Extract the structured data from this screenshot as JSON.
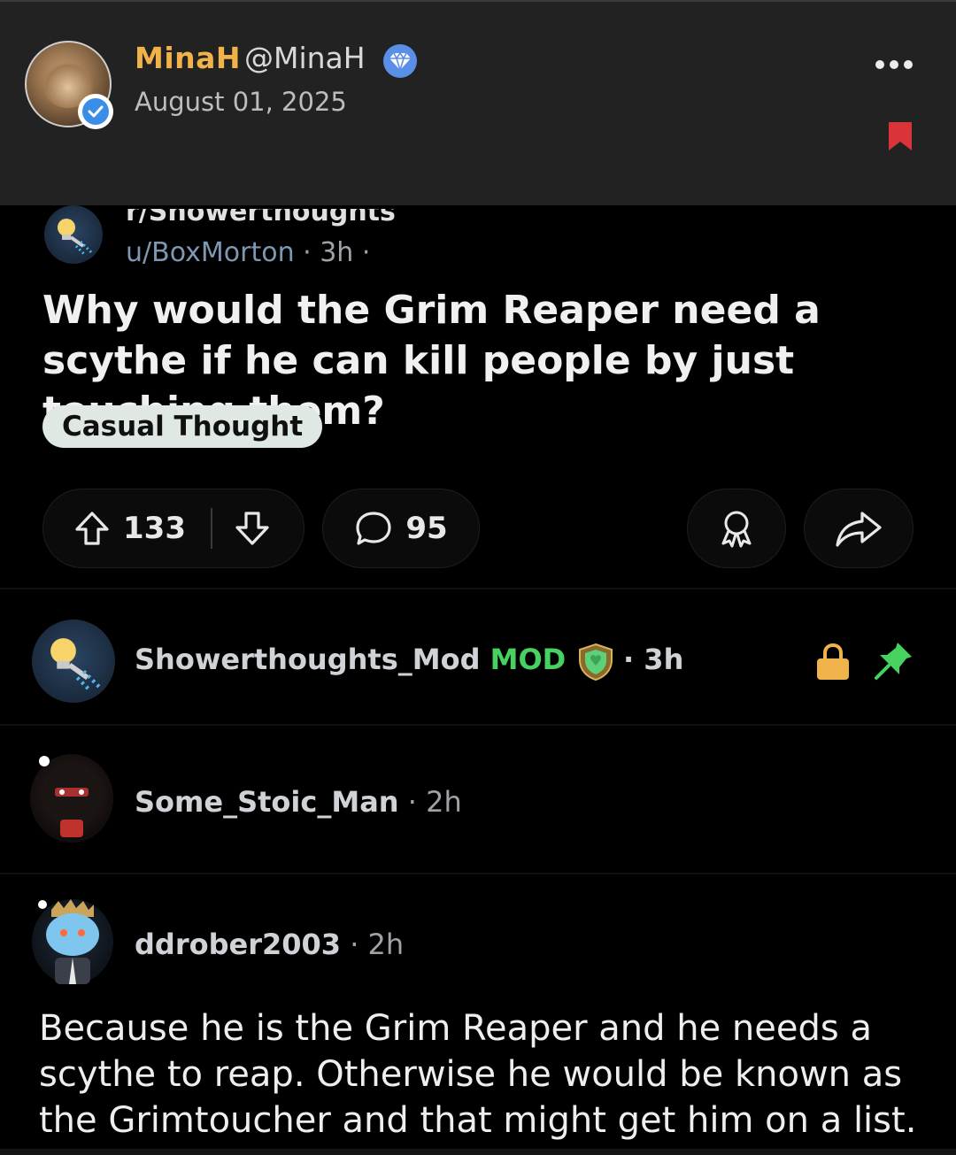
{
  "card": {
    "author_name": "MinaH",
    "author_handle": "@MinaH",
    "date": "August 01, 2025"
  },
  "post": {
    "subreddit": "r/Showerthoughts",
    "user": "u/BoxMorton",
    "meta_sep": " · ",
    "time": "3h",
    "meta_trailing": " ·",
    "title": "Why would the Grim Reaper need a scythe if he can kill people by just touching them?",
    "flair": "Casual Thought",
    "upvotes": "133",
    "comments": "95"
  },
  "comments": [
    {
      "author": "Showerthoughts_Mod",
      "mod_label": "MOD",
      "time": " · 3h"
    },
    {
      "author": "Some_Stoic_Man",
      "time": " · 2h"
    },
    {
      "author": "ddrober2003",
      "time": " · 2h",
      "body": "Because he is the Grim Reaper and he needs a scythe to reap. Otherwise he would be known as the Grimtoucher and that might get him on a list."
    }
  ],
  "colors": {
    "author_name": "#f2b24a",
    "mod_green": "#46d160",
    "bookmark_red": "#d9343a",
    "lock_orange": "#f0b24a",
    "flair_bg": "#dfe8e2"
  },
  "icons": [
    "verified-icon",
    "diamond-icon",
    "more-icon",
    "bookmark-icon",
    "lightbulb-shower-icon",
    "upvote-icon",
    "downvote-icon",
    "comment-icon",
    "award-icon",
    "share-icon",
    "shield-icon",
    "lock-icon",
    "pin-icon"
  ]
}
